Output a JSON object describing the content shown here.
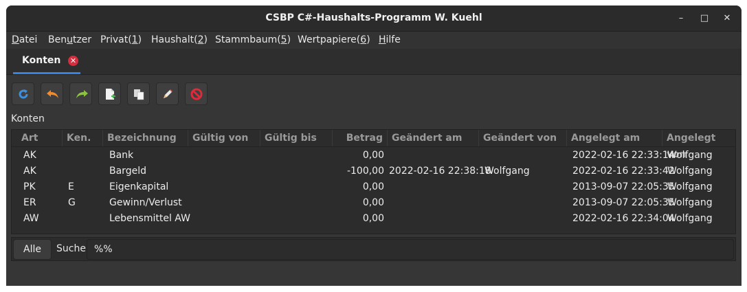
{
  "window": {
    "title": "CSBP C#-Haushalts-Programm W. Kuehl",
    "controls": [
      "–",
      "□",
      "✕"
    ]
  },
  "menu": [
    {
      "pre": "",
      "key": "D",
      "post": "atei"
    },
    {
      "pre": "Ben",
      "key": "u",
      "post": "tzer"
    },
    {
      "pre": "Privat(",
      "key": "1",
      "post": ")"
    },
    {
      "pre": "Haushalt(",
      "key": "2",
      "post": ")"
    },
    {
      "pre": "Stammbaum(",
      "key": "5",
      "post": ")"
    },
    {
      "pre": "Wertpapiere(",
      "key": "6",
      "post": ")"
    },
    {
      "pre": "",
      "key": "H",
      "post": "ilfe"
    }
  ],
  "tab": {
    "label": "Konten",
    "close": "✕"
  },
  "toolbar": [
    {
      "name": "refresh-button",
      "icon": "refresh-icon"
    },
    {
      "name": "undo-button",
      "icon": "undo-icon"
    },
    {
      "name": "redo-button",
      "icon": "redo-icon"
    },
    {
      "name": "new-button",
      "icon": "new-document-icon"
    },
    {
      "name": "copy-button",
      "icon": "copy-icon"
    },
    {
      "name": "edit-button",
      "icon": "edit-icon"
    },
    {
      "name": "delete-button",
      "icon": "delete-icon"
    }
  ],
  "section_label": "Konten",
  "table": {
    "columns": [
      "Art",
      "Ken.",
      "Bezeichnung",
      "Gültig von",
      "Gültig bis",
      "Betrag",
      "Geändert am",
      "Geändert von",
      "Angelegt am",
      "Angelegt von"
    ],
    "rows": [
      [
        "AK",
        "",
        "Bank",
        "",
        "",
        "0,00",
        "",
        "",
        "2022-02-16 22:33:14",
        "Wolfgang"
      ],
      [
        "AK",
        "",
        "Bargeld",
        "",
        "",
        "-100,00",
        "2022-02-16 22:38:18",
        "Wolfgang",
        "2022-02-16 22:33:42",
        "Wolfgang"
      ],
      [
        "PK",
        "E",
        "Eigenkapital",
        "",
        "",
        "0,00",
        "",
        "",
        "2013-09-07 22:05:35",
        "Wolfgang"
      ],
      [
        "ER",
        "G",
        "Gewinn/Verlust",
        "",
        "",
        "0,00",
        "",
        "",
        "2013-09-07 22:05:35",
        "Wolfgang"
      ],
      [
        "AW",
        "",
        "Lebensmittel AW",
        "",
        "",
        "0,00",
        "",
        "",
        "2022-02-16 22:34:04",
        "Wolfgang"
      ]
    ]
  },
  "bottom": {
    "all_button": "Alle",
    "search_label": "Suche",
    "search_value": "%%"
  }
}
